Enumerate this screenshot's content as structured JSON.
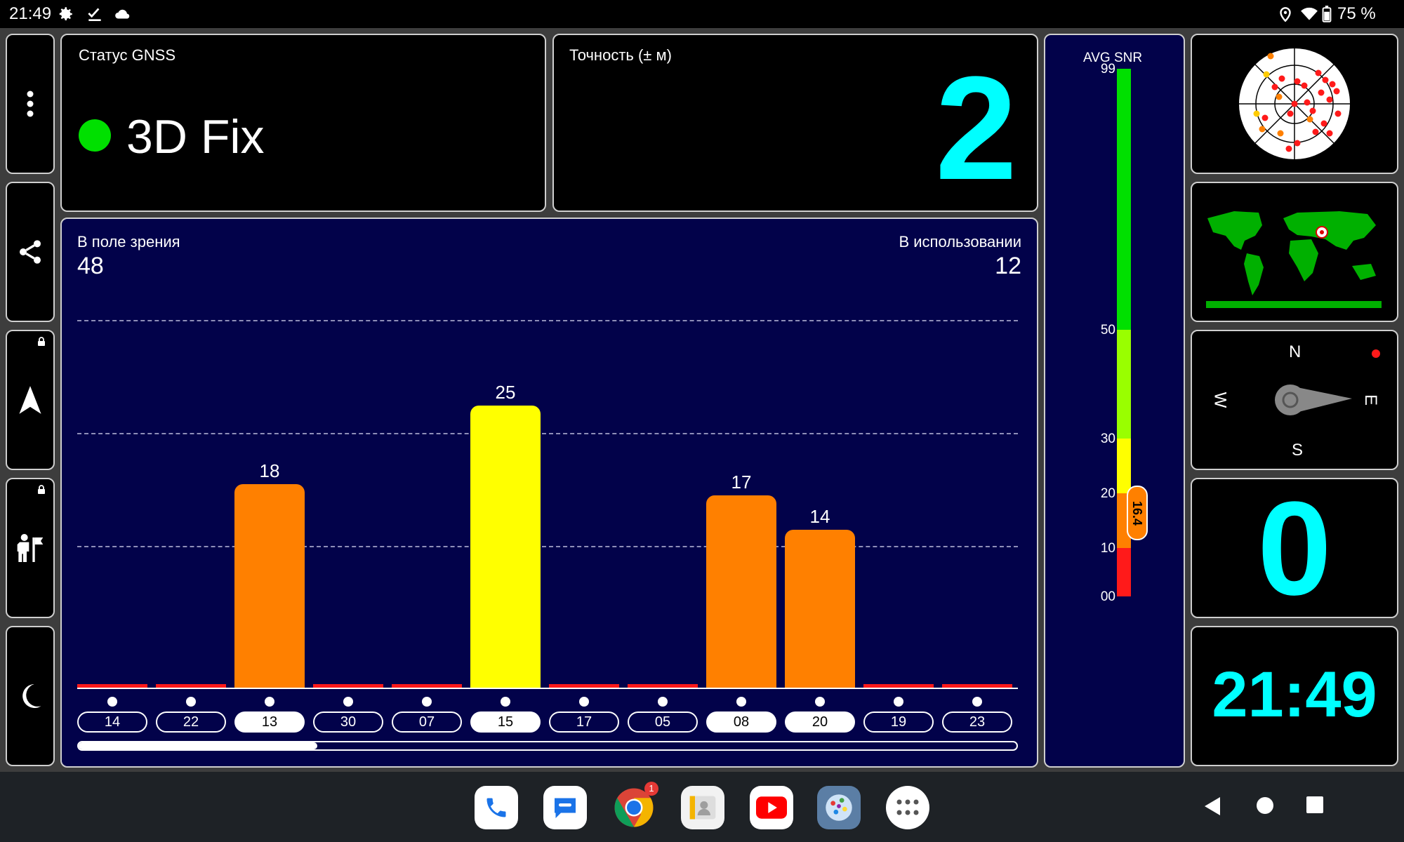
{
  "status_bar": {
    "time": "21:49",
    "battery": "75 %",
    "icons": [
      "settings-icon",
      "check-icon",
      "cloud-icon",
      "location-icon",
      "wifi-icon",
      "battery-icon"
    ]
  },
  "sidebar": {
    "items": [
      {
        "name": "menu",
        "icon": "more-vert-icon",
        "locked": false
      },
      {
        "name": "share",
        "icon": "share-icon",
        "locked": false
      },
      {
        "name": "navigation",
        "icon": "navigation-arrow-icon",
        "locked": true
      },
      {
        "name": "hiker",
        "icon": "hiker-flag-icon",
        "locked": true
      },
      {
        "name": "night-mode",
        "icon": "moon-icon",
        "locked": false
      }
    ]
  },
  "gnss_status": {
    "label": "Статус GNSS",
    "value": "3D Fix",
    "indicator_color": "#00e000"
  },
  "accuracy": {
    "label": "Точность (± м)",
    "value": "2"
  },
  "satellites": {
    "in_view_label": "В поле зрения",
    "in_view": "48",
    "in_use_label": "В использовании",
    "in_use": "12"
  },
  "chart_data": {
    "type": "bar",
    "categories": [
      "14",
      "22",
      "13",
      "30",
      "07",
      "15",
      "17",
      "05",
      "08",
      "20",
      "19",
      "23"
    ],
    "values": [
      0,
      0,
      18,
      0,
      0,
      25,
      0,
      0,
      17,
      14,
      0,
      0
    ],
    "used": [
      false,
      false,
      true,
      false,
      false,
      true,
      false,
      false,
      true,
      true,
      false,
      false
    ],
    "colors": [
      "#ff1a1a",
      "#ff1a1a",
      "#ff8000",
      "#ff1a1a",
      "#ff1a1a",
      "#ffff00",
      "#ff1a1a",
      "#ff1a1a",
      "#ff8000",
      "#ff8000",
      "#ff1a1a",
      "#ff1a1a"
    ],
    "ylim": [
      0,
      60
    ],
    "grid": true,
    "xlabel": "",
    "ylabel": ""
  },
  "snr": {
    "title": "AVG SNR",
    "ticks": [
      "99",
      "50",
      "30",
      "20",
      "10",
      "00"
    ],
    "avg_value": "16.4",
    "segments": [
      {
        "color": "#00e000",
        "from": 50,
        "to": 99
      },
      {
        "color": "#99ff00",
        "from": 30,
        "to": 50
      },
      {
        "color": "#ffff00",
        "from": 20,
        "to": 30
      },
      {
        "color": "#ff8000",
        "from": 10,
        "to": 20
      },
      {
        "color": "#ff1a1a",
        "from": 0,
        "to": 10
      }
    ]
  },
  "compass": {
    "n": "N",
    "e": "E",
    "s": "S",
    "w": "W"
  },
  "speed": {
    "value": "0"
  },
  "clock": {
    "value": "21:49"
  },
  "dock": {
    "apps": [
      "phone-icon",
      "messages-icon",
      "chrome-icon",
      "contacts-icon",
      "youtube-icon",
      "gps-app-icon",
      "app-drawer-icon"
    ],
    "chrome_badge": "1"
  },
  "colors": {
    "accent": "#00ffff",
    "panel_bg": "#000000",
    "sky_bg": "#02024a"
  }
}
